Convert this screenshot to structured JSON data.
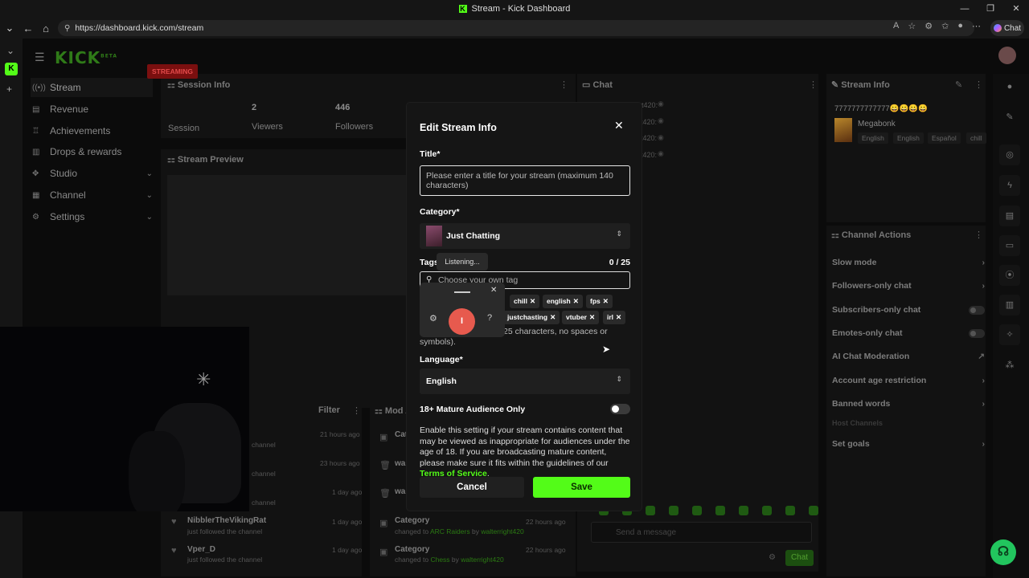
{
  "browser": {
    "window_title": "Stream - Kick Dashboard",
    "url": "https://dashboard.kick.com/stream",
    "chat_button": "Chat"
  },
  "app": {
    "logo": "KICK",
    "logo_suffix": "BETA"
  },
  "sidebar": {
    "items": [
      {
        "label": "Stream",
        "icon": "broadcast-icon"
      },
      {
        "label": "Revenue",
        "icon": "revenue-icon"
      },
      {
        "label": "Achievements",
        "icon": "trophy-icon"
      },
      {
        "label": "Drops & rewards",
        "icon": "drops-icon"
      },
      {
        "label": "Studio",
        "icon": "studio-icon"
      },
      {
        "label": "Channel",
        "icon": "channel-icon"
      },
      {
        "label": "Settings",
        "icon": "gear-icon"
      }
    ]
  },
  "session_info": {
    "title": "Session Info",
    "status_badge": "STREAMING",
    "session_label": "Session",
    "viewers_value": "2",
    "viewers_label": "Viewers",
    "followers_value": "446",
    "followers_label": "Followers"
  },
  "stream_preview": {
    "title": "Stream Preview"
  },
  "activity_feed": {
    "filter_label": "Filter",
    "entries": [
      {
        "sub": "channel",
        "time": "21 hours ago"
      },
      {
        "sub": "channel",
        "time": "23 hours ago"
      },
      {
        "sub": "channel",
        "time": "1 day ago"
      },
      {
        "sub": "channel",
        "time": "1 day ago"
      },
      {
        "name": "NibblerTheVikingRat",
        "sub": "just followed the channel",
        "time": "1 day ago"
      },
      {
        "name": "Vper_D",
        "sub": "just followed the channel",
        "time": "1 day ago"
      }
    ]
  },
  "mod_actions": {
    "title": "Mod A",
    "entries": [
      {
        "title": "Cat",
        "time": ""
      },
      {
        "title": "wa",
        "time": ""
      },
      {
        "title": "wa",
        "time": ""
      },
      {
        "title": "Category",
        "sub_prefix": "changed to",
        "target": "ARC Raiders",
        "by": "by",
        "user": "walterright420",
        "time": "22 hours ago"
      },
      {
        "title": "Category",
        "sub_prefix": "changed to",
        "target": "Chess",
        "by": "by",
        "user": "walterright420",
        "time": "22 hours ago"
      }
    ]
  },
  "chat": {
    "title": "Chat",
    "rows": [
      "ht420:",
      "t420:",
      "t420:",
      "t420:"
    ],
    "input_placeholder": "Send a message",
    "send_label": "Chat"
  },
  "stream_info": {
    "title": "Stream Info",
    "stream_title": "7777777777777😀😀😀😀",
    "category": "Megabonk",
    "tags": [
      "English",
      "English",
      "Español",
      "chill"
    ]
  },
  "channel_actions": {
    "title": "Channel Actions",
    "items": [
      {
        "label": "Slow mode",
        "control": "chevron"
      },
      {
        "label": "Followers-only chat",
        "control": "chevron"
      },
      {
        "label": "Subscribers-only chat",
        "control": "toggle"
      },
      {
        "label": "Emotes-only chat",
        "control": "toggle"
      },
      {
        "label": "AI Chat Moderation",
        "control": "external"
      },
      {
        "label": "Account age restriction",
        "control": "chevron"
      },
      {
        "label": "Banned words",
        "control": "chevron"
      },
      {
        "label": "Host Channels",
        "control": "none"
      },
      {
        "label": "Set goals",
        "control": "chevron"
      }
    ]
  },
  "modal": {
    "title": "Edit Stream Info",
    "title_label": "Title*",
    "title_placeholder": "Please enter a title for your stream (maximum 140 characters)",
    "category_label": "Category*",
    "category_value": "Just Chatting",
    "tags_label": "Tags",
    "tags_count": "0 / 25",
    "tag_placeholder": "Choose your own tag",
    "tags": [
      "chill",
      "english",
      "fps",
      "justchasting",
      "vtuber",
      "irl"
    ],
    "tag_help": "25 characters, no spaces or symbols).",
    "language_label": "Language*",
    "language_value": "English",
    "mature_label": "18+ Mature Audience Only",
    "mature_enabled": false,
    "mature_desc": "Enable this setting if your stream contains content that may be viewed as inappropriate for audiences under the age of 18. If you are broadcasting mature content, please make sure it fits within the guidelines of our ",
    "mature_link": "Terms of Service",
    "mature_end": ".",
    "cancel_label": "Cancel",
    "save_label": "Save"
  },
  "voice_popup": {
    "status": "Listening...",
    "mic_glyph": "I"
  },
  "colors": {
    "kick_green": "#53fc18",
    "streaming_red": "#e24a4a",
    "mic_red": "#e75a4e"
  }
}
